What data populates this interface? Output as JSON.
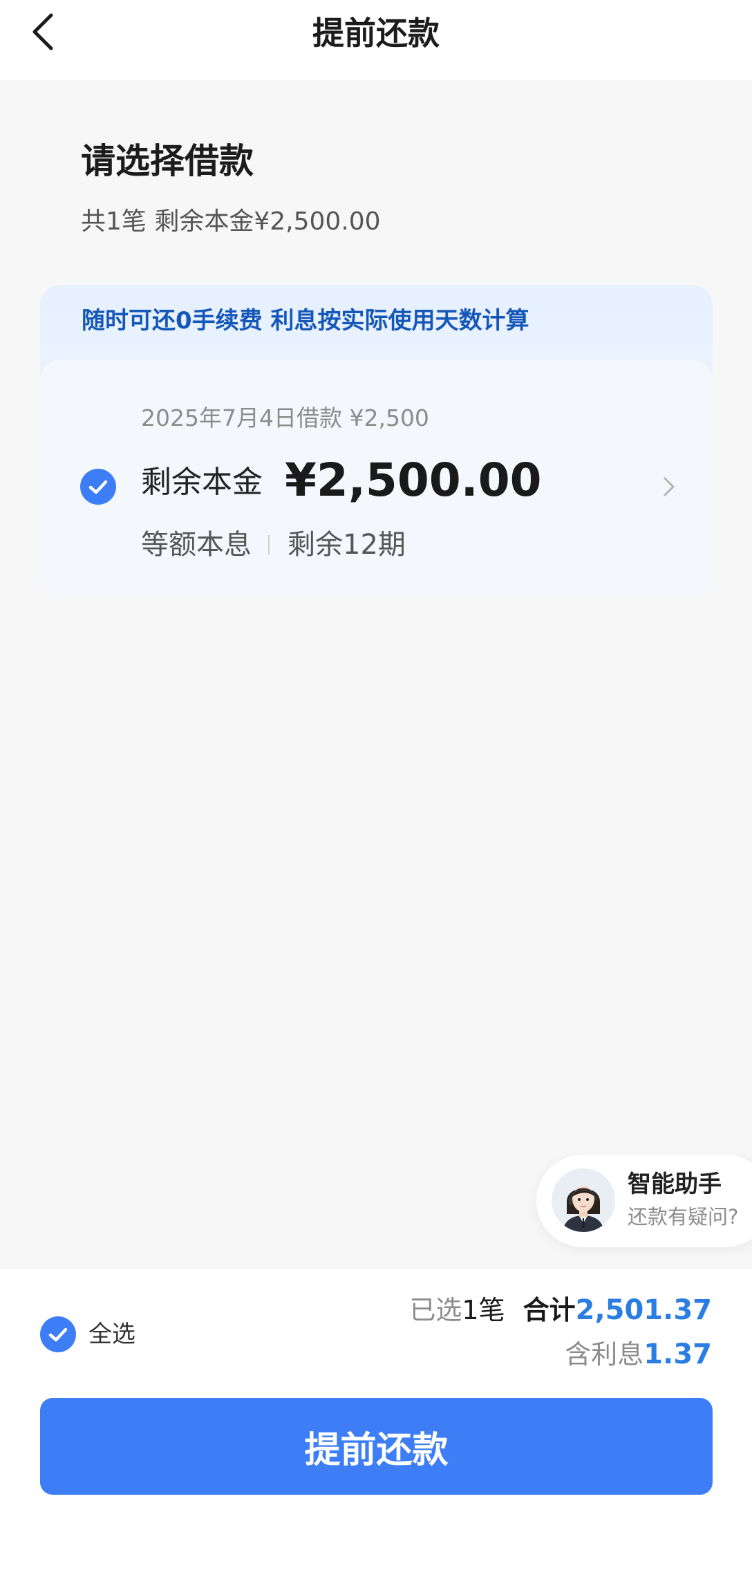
{
  "header": {
    "title": "提前还款",
    "back_icon": "chevron-left-icon"
  },
  "section": {
    "title": "请选择借款",
    "subtitle": "共1笔 剩余本金¥2,500.00"
  },
  "loan_card": {
    "banner": "随时可还0手续费 利息按实际使用天数计算",
    "loan_date": "2025年7月4日借款 ¥2,500",
    "remain_label": "剩余本金",
    "remain_amount": "¥2,500.00",
    "repay_method": "等额本息",
    "remain_periods": "剩余12期",
    "selected": true
  },
  "assistant": {
    "name": "智能助手",
    "subtitle": "还款有疑问?"
  },
  "bottom": {
    "select_all_label": "全选",
    "selected_prefix": "已选",
    "selected_count": "1",
    "selected_suffix": "笔",
    "total_label": "合计",
    "total_value": "2,501.37",
    "interest_label": "含利息",
    "interest_value": "1.37",
    "button_label": "提前还款"
  },
  "colors": {
    "accent": "#3d7df6",
    "amount_blue": "#2a7de1",
    "banner_text": "#1557b8",
    "background": "#f7f7f7"
  }
}
